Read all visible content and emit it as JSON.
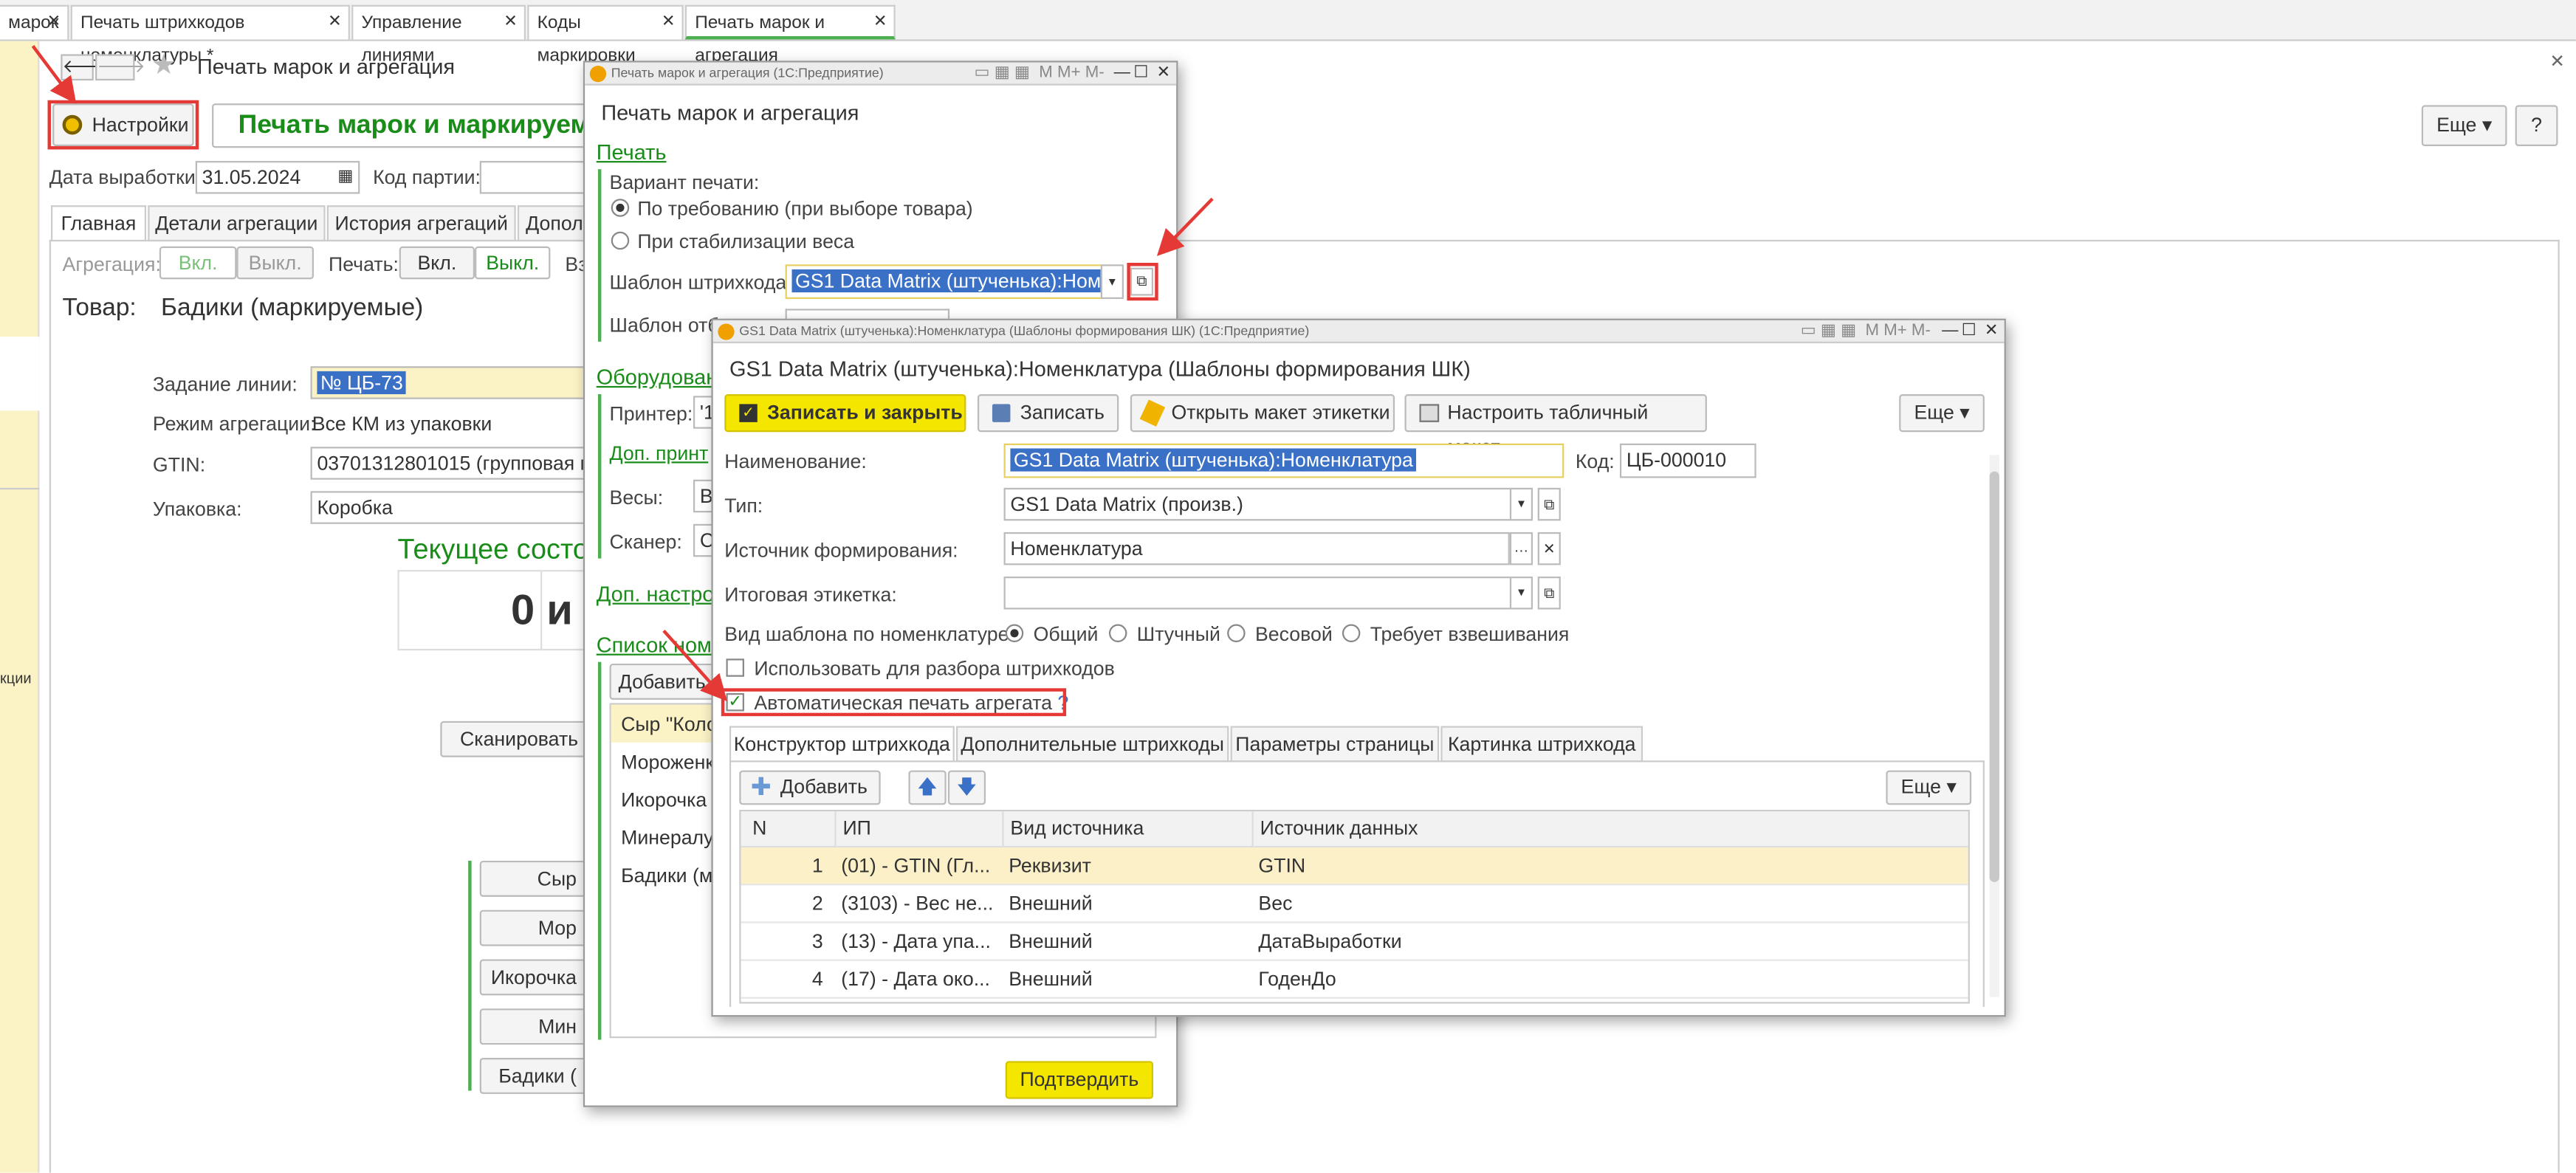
{
  "tabs": [
    "марок",
    "Печать штрихкодов номенклатуры *",
    "Управление линиями",
    "Коды маркировки",
    "Печать марок и агрегация"
  ],
  "main": {
    "title": "Печать марок и агрегация",
    "settings_btn": "Настройки",
    "header": "Печать марок и маркируема",
    "more": "Еще",
    "help": "?",
    "date_lbl": "Дата выработки:",
    "date_val": "31.05.2024",
    "batch_lbl": "Код партии:",
    "tabs": [
      "Главная",
      "Детали агрегации",
      "История агрегаций",
      "Допол"
    ],
    "aggr_lbl": "Агрегация:",
    "on": "Вкл.",
    "off": "Выкл.",
    "print_lbl": "Печать:",
    "v_frag": "Вз",
    "product_lbl": "Товар:",
    "product_val": "Бадики (маркируемые)",
    "task_lbl": "Задание линии:",
    "task_val": "№ ЦБ-73",
    "mode_lbl": "Режим агрегации:",
    "mode_val": "Все КМ из упаковки",
    "gtin_lbl": "GTIN:",
    "gtin_val": "03701312801015 (групповая по",
    "pack_lbl": "Упаковка:",
    "pack_val": "Коробка",
    "state": "Текущее состо",
    "count": "0 и",
    "scan_btn": "Сканировать ц",
    "left_btns": [
      "Сыр",
      "Мор",
      "Икорочка",
      "Мин",
      "Бадики ("
    ],
    "strip_words": [
      "кции"
    ]
  },
  "dlg1": {
    "wtitle": "Печать марок и агрегация (1С:Предприятие)",
    "title": "Печать марок и агрегация",
    "print_hdr": "Печать",
    "variant_lbl": "Вариант печати:",
    "radio1": "По требованию (при выборе товара)",
    "radio2": "При стабилизации веса",
    "tpl_lbl": "Шаблон штрихкода:",
    "tpl_val": "GS1 Data Matrix (штученька):Номен",
    "tpl2_lbl": "Шаблон отб",
    "equip_hdr": "Оборудован",
    "printer_lbl": "Принтер:",
    "printer_val": "'1",
    "dop_print": "Доп. принт",
    "scales_lbl": "Весы:",
    "scales_val": "В",
    "scanner_lbl": "Сканер:",
    "scanner_val": "С",
    "dop_settings": "Доп. настро",
    "list_hdr": "Список ном",
    "add_btn": "Добавить",
    "list": [
      "Сыр \"Коло",
      "Мороженко",
      "Икорочка (",
      "Минералуш",
      "Бадики (ма"
    ],
    "confirm": "Подтвердить"
  },
  "dlg2": {
    "wtitle": "GS1 Data Matrix (штученька):Номенклатура (Шаблоны формирования ШК) (1С:Предприятие)",
    "title": "GS1 Data Matrix (штученька):Номенклатура (Шаблоны формирования ШК)",
    "save_close": "Записать и закрыть",
    "save": "Записать",
    "open_layout": "Открыть макет этикетки",
    "config_layout": "Настроить табличный макет",
    "more": "Еще",
    "name_lbl": "Наименование:",
    "name_val": "GS1 Data Matrix (штученька):Номенклатура",
    "code_lbl": "Код:",
    "code_val": "ЦБ-000010",
    "type_lbl": "Тип:",
    "type_val": "GS1 Data Matrix (произв.)",
    "source_lbl": "Источник формирования:",
    "source_val": "Номенклатура",
    "final_lbl": "Итоговая этикетка:",
    "kind_lbl": "Вид шаблона по номенклатуре:",
    "kinds": [
      "Общий",
      "Штучный",
      "Весовой",
      "Требует взвешивания"
    ],
    "use_parse": "Использовать для разбора штрихкодов",
    "auto_print": "Автоматическая печать агрегата",
    "q": "?",
    "tabs": [
      "Конструктор штрихкода",
      "Дополнительные штрихкоды",
      "Параметры страницы",
      "Картинка штрихкода"
    ],
    "add": "Добавить",
    "more2": "Еще",
    "cols": [
      "N",
      "ИП",
      "Вид источника",
      "Источник данных"
    ],
    "rows": [
      {
        "n": "1",
        "ip": "(01) - GTIN (Гл...",
        "kind": "Реквизит",
        "src": "GTIN"
      },
      {
        "n": "2",
        "ip": "(3103) - Вес не...",
        "kind": "Внешний",
        "src": "Вес"
      },
      {
        "n": "3",
        "ip": "(13) - Дата упа...",
        "kind": "Внешний",
        "src": "ДатаВыработки"
      },
      {
        "n": "4",
        "ip": "(17) - Дата око...",
        "kind": "Внешний",
        "src": "ГоденДо"
      }
    ]
  },
  "colors": {
    "accent_green": "#1a8c1a",
    "highlight": "#fbf3c6",
    "annotation_red": "#e53935",
    "selection": "#3a70c6",
    "confirm_yellow": "#f5e600"
  }
}
